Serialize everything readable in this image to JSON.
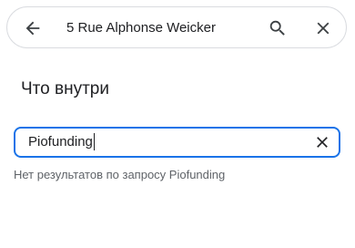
{
  "search": {
    "query": "5 Rue Alphonse Weicker",
    "back_icon": "arrow-left-icon",
    "search_icon": "search-icon",
    "close_icon": "close-icon"
  },
  "section": {
    "title": "Что внутри"
  },
  "filter": {
    "value": "Piofunding",
    "clear_icon": "close-icon",
    "accent_color": "#1a73e8"
  },
  "results": {
    "message": "Нет результатов по запросу Piofunding"
  }
}
